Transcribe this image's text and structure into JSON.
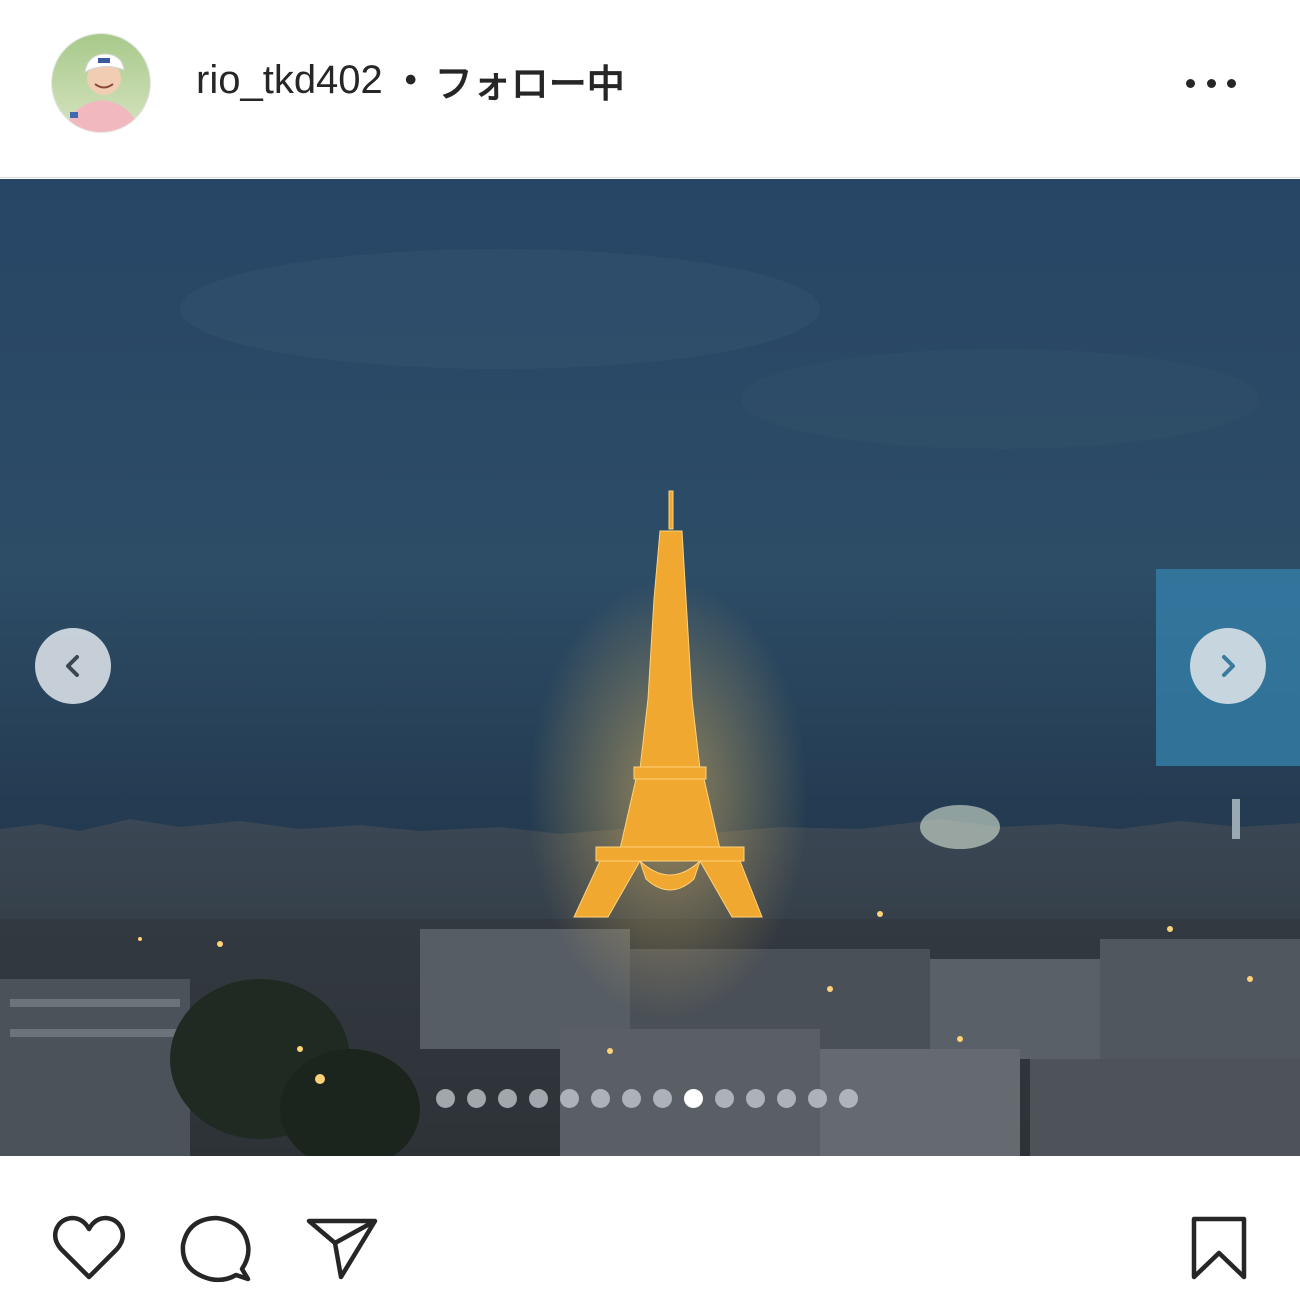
{
  "header": {
    "username": "rio_tkd402",
    "separator": "•",
    "follow_status": "フォロー中",
    "more_icon": "more-horizontal-icon"
  },
  "post": {
    "image_description_icon": "photo",
    "carousel": {
      "total_slides": 14,
      "active_index": 8
    }
  },
  "actions": {
    "like_icon": "heart-icon",
    "comment_icon": "comment-icon",
    "share_icon": "send-icon",
    "save_icon": "bookmark-icon"
  },
  "colors": {
    "text": "#262626",
    "sky": "#2a4863",
    "tower": "#f0a830",
    "next_highlight": "#3480aa"
  }
}
